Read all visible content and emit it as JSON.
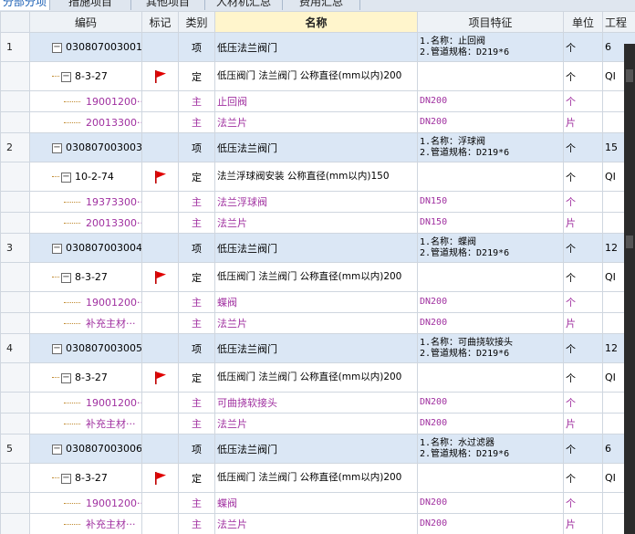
{
  "tabs": [
    "分部分项",
    "措施项目",
    "其他项目",
    "人材机汇总",
    "费用汇总"
  ],
  "headers": {
    "rownum": "",
    "code": "编码",
    "mark": "标记",
    "type": "类别",
    "name": "名称",
    "feature": "项目特征",
    "unit": "单位",
    "qty": "工程"
  },
  "rows": [
    {
      "kind": "item",
      "num": "1",
      "code": "030807003001",
      "type": "项",
      "name": "低压法兰阀门",
      "feature": "1.名称：止回阀\n2.管道规格：D219*6",
      "unit": "个",
      "qty": "6"
    },
    {
      "kind": "quota",
      "code": "8-3-27",
      "flag": true,
      "type": "定",
      "name": "低压阀门 法兰阀门 公称直径(mm以内)200",
      "feature": "",
      "unit": "个",
      "qty": "QI"
    },
    {
      "kind": "mat",
      "code": "19001200···",
      "type": "主",
      "name": "止回阀",
      "feature": "DN200",
      "unit": "个",
      "qty": ""
    },
    {
      "kind": "mat",
      "code": "20013300···",
      "type": "主",
      "name": "法兰片",
      "feature": "DN200",
      "unit": "片",
      "qty": ""
    },
    {
      "kind": "item",
      "num": "2",
      "code": "030807003003",
      "type": "项",
      "name": "低压法兰阀门",
      "feature": "1.名称：浮球阀\n2.管道规格：D219*6",
      "unit": "个",
      "qty": "15"
    },
    {
      "kind": "quota",
      "code": "10-2-74",
      "flag": true,
      "type": "定",
      "name": "法兰浮球阀安装 公称直径(mm以内)150",
      "feature": "",
      "unit": "个",
      "qty": "QI"
    },
    {
      "kind": "mat",
      "code": "19373300···",
      "type": "主",
      "name": "法兰浮球阀",
      "feature": "DN150",
      "unit": "个",
      "qty": ""
    },
    {
      "kind": "mat",
      "code": "20013300···",
      "type": "主",
      "name": "法兰片",
      "feature": "DN150",
      "unit": "片",
      "qty": ""
    },
    {
      "kind": "item",
      "num": "3",
      "code": "030807003004",
      "type": "项",
      "name": "低压法兰阀门",
      "feature": "1.名称：蝶阀\n2.管道规格：D219*6",
      "unit": "个",
      "qty": "12"
    },
    {
      "kind": "quota",
      "code": "8-3-27",
      "flag": true,
      "type": "定",
      "name": "低压阀门 法兰阀门 公称直径(mm以内)200",
      "feature": "",
      "unit": "个",
      "qty": "QI"
    },
    {
      "kind": "mat",
      "code": "19001200···",
      "type": "主",
      "name": "蝶阀",
      "feature": "DN200",
      "unit": "个",
      "qty": ""
    },
    {
      "kind": "mat",
      "code": "补充主材···",
      "type": "主",
      "name": "法兰片",
      "feature": "DN200",
      "unit": "片",
      "qty": ""
    },
    {
      "kind": "item",
      "num": "4",
      "code": "030807003005",
      "type": "项",
      "name": "低压法兰阀门",
      "feature": "1.名称：可曲挠软接头\n2.管道规格：D219*6",
      "unit": "个",
      "qty": "12"
    },
    {
      "kind": "quota",
      "code": "8-3-27",
      "flag": true,
      "type": "定",
      "name": "低压阀门 法兰阀门 公称直径(mm以内)200",
      "feature": "",
      "unit": "个",
      "qty": "QI"
    },
    {
      "kind": "mat",
      "code": "19001200···",
      "type": "主",
      "name": "可曲挠软接头",
      "feature": "DN200",
      "unit": "个",
      "qty": ""
    },
    {
      "kind": "mat",
      "code": "补充主材···",
      "type": "主",
      "name": "法兰片",
      "feature": "DN200",
      "unit": "片",
      "qty": ""
    },
    {
      "kind": "item",
      "num": "5",
      "code": "030807003006",
      "type": "项",
      "name": "低压法兰阀门",
      "feature": "1.名称：水过滤器\n2.管道规格：D219*6",
      "unit": "个",
      "qty": "6"
    },
    {
      "kind": "quota",
      "code": "8-3-27",
      "flag": true,
      "type": "定",
      "name": "低压阀门 法兰阀门 公称直径(mm以内)200",
      "feature": "",
      "unit": "个",
      "qty": "QI"
    },
    {
      "kind": "mat",
      "code": "19001200···",
      "type": "主",
      "name": "蝶阀",
      "feature": "DN200",
      "unit": "个",
      "qty": ""
    },
    {
      "kind": "mat",
      "code": "补充主材···",
      "type": "主",
      "name": "法兰片",
      "feature": "DN200",
      "unit": "片",
      "qty": ""
    }
  ],
  "colors": {
    "item_row": "#dbe7f5",
    "material_text": "#a030a0",
    "flag": "#e00000",
    "header_sorted": "#fff5cc"
  }
}
